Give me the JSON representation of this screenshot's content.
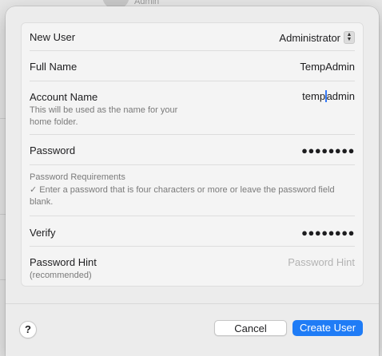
{
  "background": {
    "admin_label": "Admin"
  },
  "form": {
    "new_user": {
      "label": "New User",
      "selected": "Administrator"
    },
    "full_name": {
      "label": "Full Name",
      "value": "TempAdmin"
    },
    "account_name": {
      "label": "Account Name",
      "hint": "This will be used as the name for your home folder.",
      "value_before_caret": "temp",
      "value_after_caret": "admin"
    },
    "password": {
      "label": "Password",
      "value_masked": "●●●●●●●●"
    },
    "requirements": {
      "title": "Password Requirements",
      "rule": "✓ Enter a password that is four characters or more or leave the password field blank."
    },
    "verify": {
      "label": "Verify",
      "value_masked": "●●●●●●●●"
    },
    "hint": {
      "label": "Password Hint",
      "sublabel": "(recommended)",
      "placeholder": "Password Hint"
    }
  },
  "footer": {
    "help_label": "?",
    "cancel_label": "Cancel",
    "create_label": "Create User"
  },
  "colors": {
    "accent": "#1f7cf6",
    "caret": "#3478f6"
  }
}
